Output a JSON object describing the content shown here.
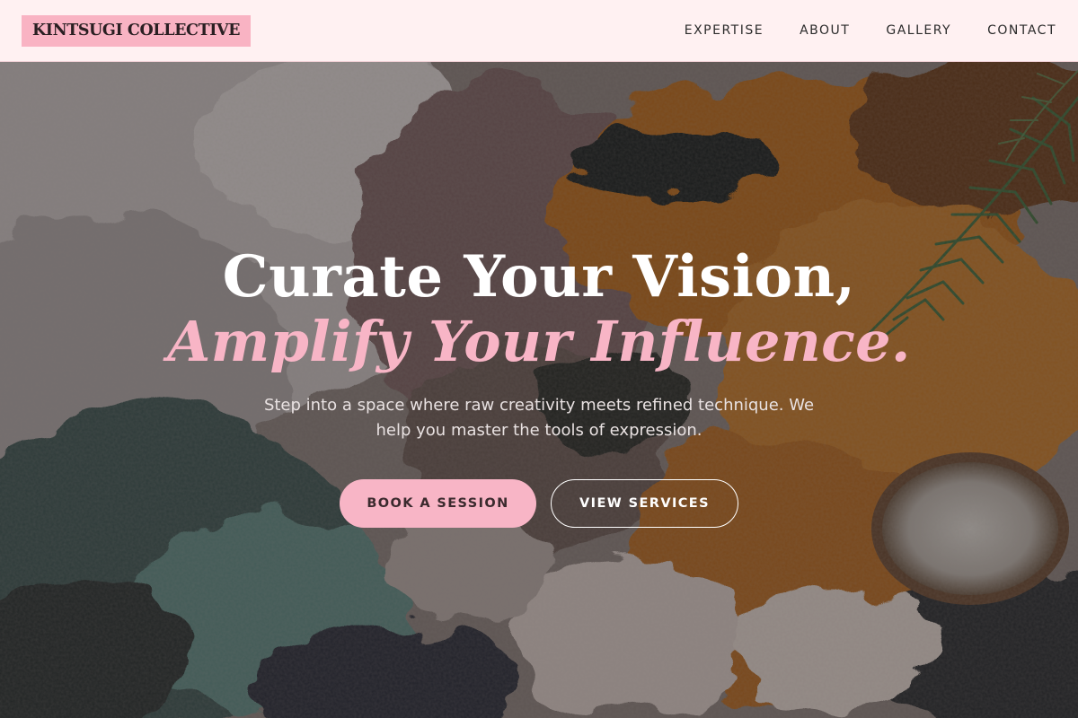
{
  "brand": {
    "name": "KINTSUGI COLLECTIVE"
  },
  "nav": {
    "items": [
      {
        "label": "EXPERTISE"
      },
      {
        "label": "ABOUT"
      },
      {
        "label": "GALLERY"
      },
      {
        "label": "CONTACT"
      }
    ]
  },
  "hero": {
    "headline_line1": "Curate Your Vision,",
    "headline_line2": "Amplify Your Influence.",
    "subtitle": "Step into a space where raw creativity meets refined technique. We help you master the tools of expression.",
    "primary_button": "BOOK A SESSION",
    "secondary_button": "VIEW SERVICES",
    "background_alt": "Close-up of textured oil paint strokes on a palette with rosemary sprig"
  },
  "colors": {
    "accent_pink": "#f8b5c6",
    "nav_background": "#fff1f2",
    "text_dark": "#2b2b2b"
  }
}
